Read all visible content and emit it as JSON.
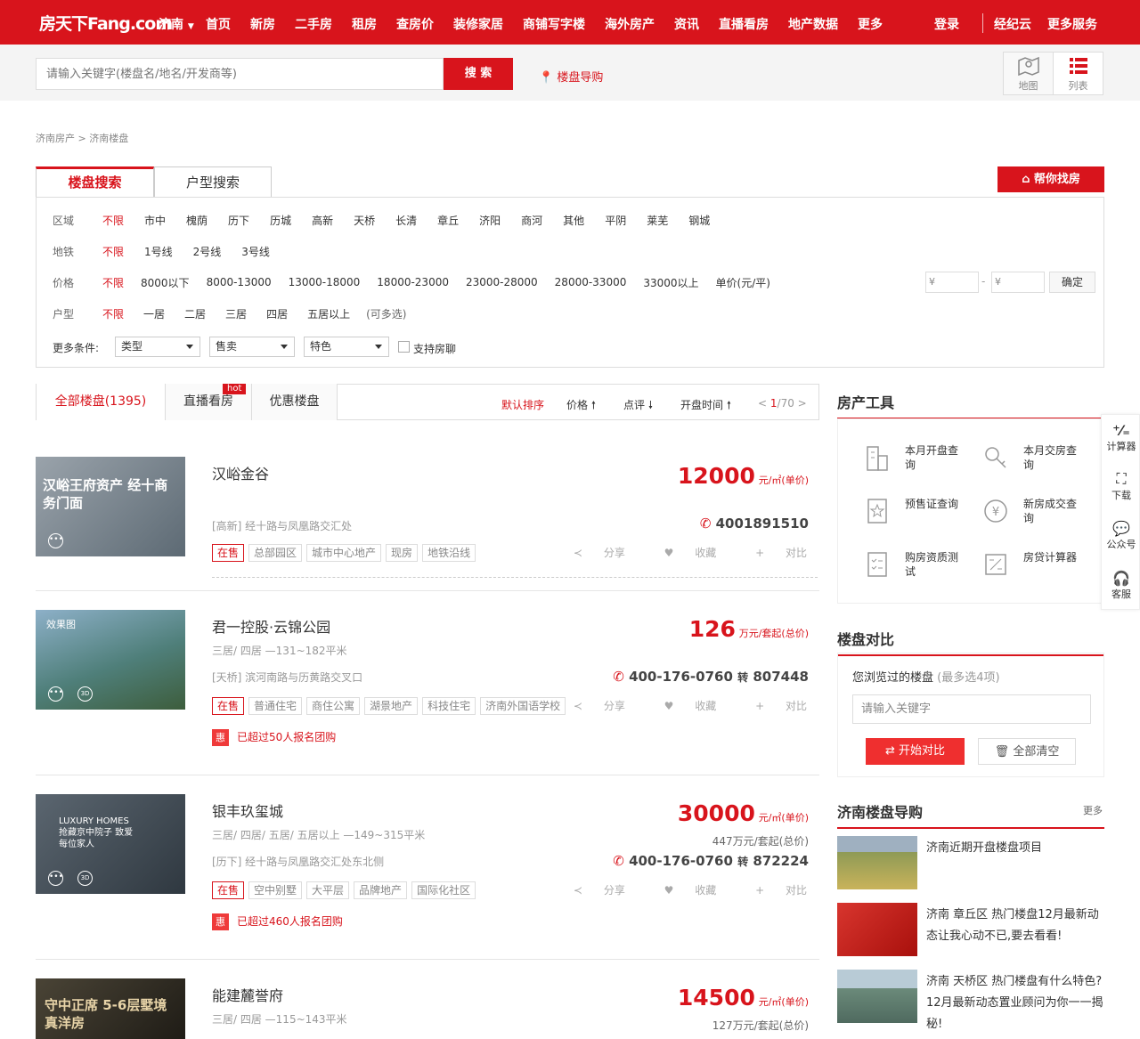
{
  "nav": {
    "logo": "房天下Fang.com",
    "city": "济南",
    "menu": [
      "首页",
      "新房",
      "二手房",
      "租房",
      "查房价",
      "装修家居",
      "商铺写字楼",
      "海外房产",
      "资讯",
      "直播看房",
      "地产数据",
      "更多"
    ],
    "login": "登录",
    "agent": "经纪云",
    "more_services": "更多服务"
  },
  "search": {
    "placeholder": "请输入关键字(楼盘名/地名/开发商等)",
    "button": "搜 索",
    "guide_link": "楼盘导购",
    "map_label": "地图",
    "list_label": "列表"
  },
  "breadcrumb": [
    "济南房产",
    "济南楼盘"
  ],
  "search_tabs": [
    "楼盘搜索",
    "户型搜索"
  ],
  "help_button": "帮你找房",
  "filters": {
    "region": {
      "label": "区域",
      "options": [
        "不限",
        "市中",
        "槐荫",
        "历下",
        "历城",
        "高新",
        "天桥",
        "长清",
        "章丘",
        "济阳",
        "商河",
        "其他",
        "平阴",
        "莱芜",
        "钢城"
      ]
    },
    "metro": {
      "label": "地铁",
      "options": [
        "不限",
        "1号线",
        "2号线",
        "3号线"
      ]
    },
    "price": {
      "label": "价格",
      "options": [
        "不限",
        "8000以下",
        "8000-13000",
        "13000-18000",
        "18000-23000",
        "23000-28000",
        "28000-33000",
        "33000以上",
        "单价(元/平)"
      ]
    },
    "layout": {
      "label": "户型",
      "options": [
        "不限",
        "一居",
        "二居",
        "三居",
        "四居",
        "五居以上",
        "(可多选)"
      ]
    },
    "price_min_placeholder": "¥",
    "price_max_placeholder": "¥",
    "confirm": "确定",
    "more_label": "更多条件:",
    "dropdowns": [
      "类型",
      "售卖",
      "特色"
    ],
    "checkbox_label": "支持房聊"
  },
  "list_tabs": {
    "all": "全部楼盘(1395)",
    "live": "直播看房",
    "hot_badge": "hot",
    "discount": "优惠楼盘",
    "sort_default": "默认排序",
    "sort_price": "价格",
    "sort_review": "点评",
    "sort_open": "开盘时间",
    "page_current": "1",
    "page_total": "/70"
  },
  "listings": [
    {
      "name": "汉峪金谷",
      "layout": "",
      "address": "[高新] 经十路与凤凰路交汇处",
      "price": "12000",
      "price_unit": "元/㎡(单价)",
      "total": "",
      "tel": "4001891510",
      "tel_ext": "",
      "tags": [
        "在售",
        "总部园区",
        "城市中心地产",
        "现房",
        "地铁沿线"
      ],
      "group": "",
      "img_text": "汉峪王府资产 经十商务门面",
      "img_color": "#6d7a86"
    },
    {
      "name": "君一控股·云锦公园",
      "layout": "三居/ 四居 —131~182平米",
      "address": "[天桥] 滨河南路与历黄路交叉口",
      "price": "126",
      "price_unit": "万元/套起(总价)",
      "total": "",
      "tel": "400-176-0760",
      "tel_ext": "807448",
      "tags": [
        "在售",
        "普通住宅",
        "商住公寓",
        "湖景地产",
        "科技住宅",
        "济南外国语学校"
      ],
      "group": "已超过50人报名团购",
      "img_text": "效果图",
      "img_color": "#4e7a94"
    },
    {
      "name": "银丰玖玺城",
      "layout": "三居/ 四居/ 五居/ 五居以上 —149~315平米",
      "address": "[历下] 经十路与凤凰路交汇处东北侧",
      "price": "30000",
      "price_unit": "元/㎡(单价)",
      "total": "447万元/套起(总价)",
      "tel": "400-176-0760",
      "tel_ext": "872224",
      "tags": [
        "在售",
        "空中别墅",
        "大平层",
        "品牌地产",
        "国际化社区"
      ],
      "group": "已超过460人报名团购",
      "img_text": "LUXURY HOMES 抢藏京中院子 致爱每位家人",
      "img_color": "#3f4a55"
    },
    {
      "name": "能建麓誉府",
      "layout": "三居/ 四居 —115~143平米",
      "address": "",
      "price": "14500",
      "price_unit": "元/㎡(单价)",
      "total": "127万元/套起(总价)",
      "tel": "",
      "tel_ext": "",
      "tags": [],
      "group": "",
      "img_text": "守中正席 5-6层墅境真洋房",
      "img_color": "#2f2a22"
    }
  ],
  "actions": {
    "share": "分享",
    "fav": "收藏",
    "compare": "对比",
    "transfer": "转"
  },
  "tools": {
    "title": "房产工具",
    "items": [
      "本月开盘查询",
      "本月交房查询",
      "预售证查询",
      "新房成交查询",
      "购房资质测试",
      "房贷计算器"
    ]
  },
  "compare": {
    "title": "楼盘对比",
    "hint": "您浏览过的楼盘",
    "hint_sub": "(最多选4项)",
    "placeholder": "请输入关键字",
    "start": "开始对比",
    "clear": "全部清空"
  },
  "guide": {
    "title": "济南楼盘导购",
    "more": "更多",
    "items": [
      {
        "text": "济南近期开盘楼盘项目",
        "color": "#7d8a5a"
      },
      {
        "text": "济南 章丘区 热门楼盘12月最新动态让我心动不已,要去看看!",
        "color": "#c8231e"
      },
      {
        "text": "济南 天桥区 热门楼盘有什么特色?12月最新动态置业顾问为你一一揭秘!",
        "color": "#5a7a7e"
      }
    ]
  },
  "float_bar": [
    "计算器",
    "下载",
    "公众号",
    "客服"
  ],
  "colors": {
    "brand": "#d8141c"
  }
}
